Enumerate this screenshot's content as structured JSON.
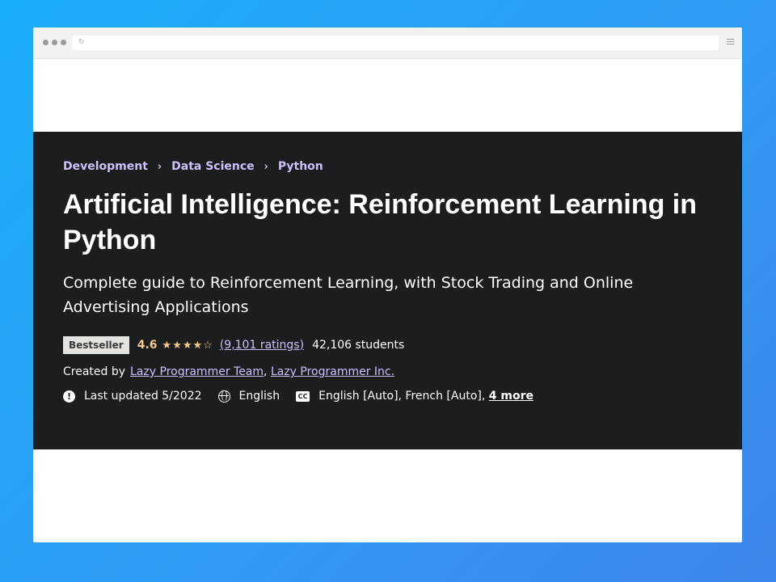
{
  "breadcrumb": [
    "Development",
    "Data Science",
    "Python"
  ],
  "course": {
    "title": "Artificial Intelligence: Reinforcement Learning in Python",
    "subtitle": "Complete guide to Reinforcement Learning, with Stock Trading and Online Advertising Applications",
    "badge": "Bestseller",
    "rating": "4.6",
    "stars": "★★★★☆",
    "ratings_count": "(9,101 ratings)",
    "students": "42,106 students",
    "created_label": "Created by",
    "instructors": [
      "Lazy Programmer Team",
      "Lazy Programmer Inc."
    ],
    "last_updated": "Last updated 5/2022",
    "language": "English",
    "captions": "English [Auto], French [Auto],",
    "captions_more": "4 more"
  },
  "icons": {
    "alert": "alert-icon",
    "globe": "globe-icon",
    "captions": "closed-captions-icon"
  },
  "colors": {
    "background_gradient_start": "#1aaef8",
    "background_gradient_end": "#3f86ea",
    "hero_background": "#1c1d1f",
    "link": "#cec0fc",
    "rating": "#f3ca8c"
  }
}
